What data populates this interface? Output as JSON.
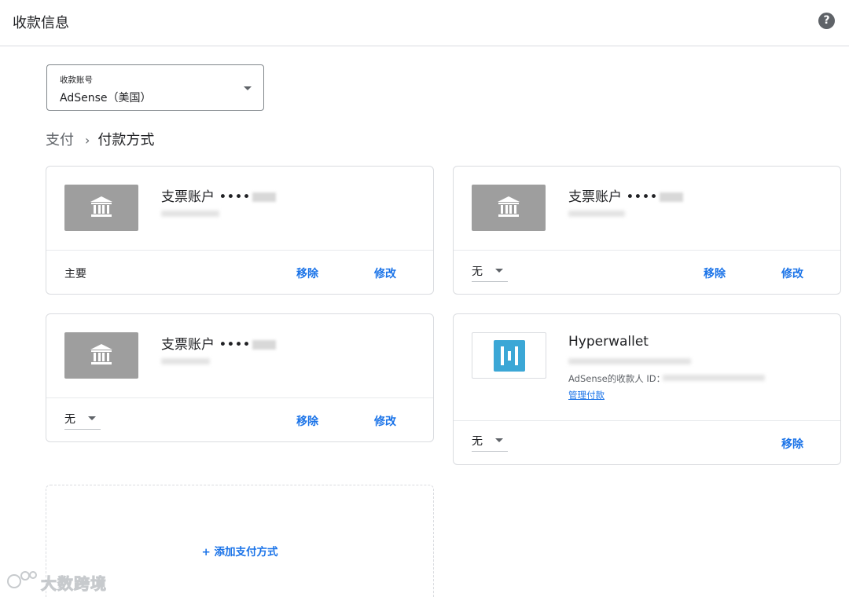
{
  "header": {
    "title": "收款信息",
    "help_icon": "help-icon",
    "help_glyph": "?"
  },
  "account_select": {
    "label": "收款账号",
    "value": "AdSense（美国）"
  },
  "breadcrumb": {
    "parent": "支付",
    "separator": "›",
    "current": "付款方式"
  },
  "cards": [
    {
      "title": "支票账户 ••••",
      "status": "主要",
      "remove_label": "移除",
      "edit_label": "修改"
    },
    {
      "title": "支票账户 ••••",
      "status": "无",
      "remove_label": "移除",
      "edit_label": "修改"
    },
    {
      "title": "支票账户 ••••",
      "status": "无",
      "remove_label": "移除",
      "edit_label": "修改"
    }
  ],
  "hyperwallet": {
    "title": "Hyperwallet",
    "payee_label": "AdSense的收款人 ID：",
    "manage_label": "管理付款",
    "status": "无",
    "remove_label": "移除"
  },
  "add_payment": {
    "label": "+ 添加支付方式"
  },
  "watermark": {
    "text": "大数跨境"
  },
  "colors": {
    "link": "#1a73e8",
    "bank_logo_bg": "#9e9e9e",
    "hyperwallet_brand": "#3ba7d6",
    "border": "#dadce0"
  }
}
